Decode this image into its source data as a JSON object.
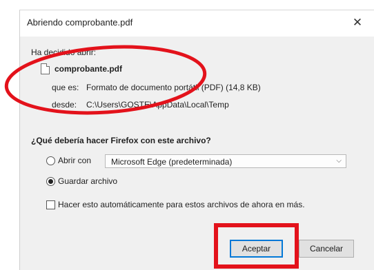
{
  "window": {
    "title": "Abriendo comprobante.pdf",
    "close_glyph": "✕"
  },
  "info": {
    "heading": "Ha decidido abrir:",
    "file_icon": "pdf-file-icon",
    "filename": "comprobante.pdf",
    "type_label": "que es:",
    "type_value": "Formato de documento portátil (PDF) (14,8 KB)",
    "from_label": "desde:",
    "from_value": "C:\\Users\\GOSTE\\AppData\\Local\\Temp"
  },
  "question": "¿Qué debería hacer Firefox con este archivo?",
  "options": {
    "open_with_label": "Abrir con",
    "open_with_selected": false,
    "app_select_value": "Microsoft Edge (predeterminada)",
    "save_label": "Guardar archivo",
    "save_selected": true,
    "auto_label": "Hacer esto automáticamente para estos archivos de ahora en más.",
    "auto_checked": false
  },
  "buttons": {
    "accept": "Aceptar",
    "cancel": "Cancelar"
  },
  "annotations": {
    "highlight_color": "#e3121b"
  }
}
